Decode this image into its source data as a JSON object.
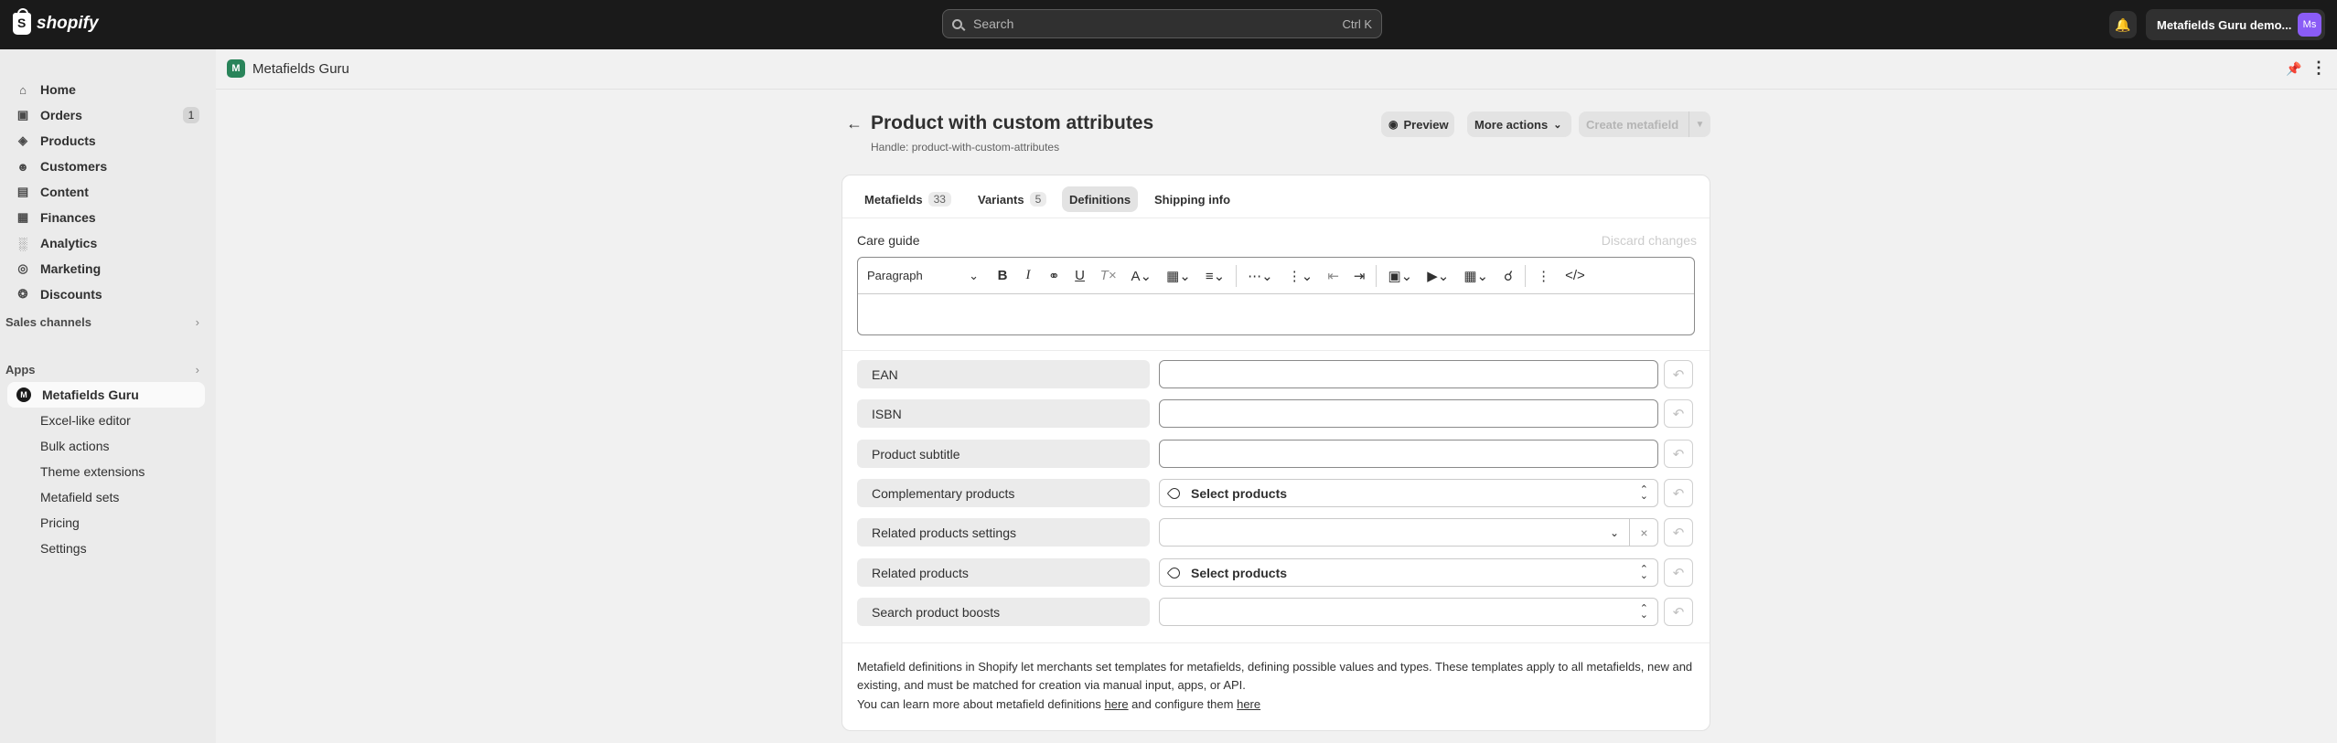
{
  "topbar": {
    "brand": "shopify",
    "search_placeholder": "Search",
    "search_shortcut": "Ctrl K",
    "store_name": "Metafields Guru demo...",
    "avatar_initials": "Ms"
  },
  "sidebar": {
    "items": [
      {
        "label": "Home",
        "icon": "home-icon"
      },
      {
        "label": "Orders",
        "icon": "orders-icon",
        "badge": "1"
      },
      {
        "label": "Products",
        "icon": "tag-icon"
      },
      {
        "label": "Customers",
        "icon": "person-icon"
      },
      {
        "label": "Content",
        "icon": "content-icon"
      },
      {
        "label": "Finances",
        "icon": "bank-icon"
      },
      {
        "label": "Analytics",
        "icon": "chart-icon"
      },
      {
        "label": "Marketing",
        "icon": "target-icon"
      },
      {
        "label": "Discounts",
        "icon": "discount-icon"
      }
    ],
    "sales_channels": "Sales channels",
    "apps": "Apps",
    "app_name": "Metafields Guru",
    "app_sub_items": [
      "Excel-like editor",
      "Bulk actions",
      "Theme extensions",
      "Metafield sets",
      "Pricing",
      "Settings"
    ]
  },
  "app_header": {
    "title": "Metafields Guru"
  },
  "page": {
    "title": "Product with custom attributes",
    "handle": "Handle: product-with-custom-attributes",
    "preview_label": "Preview",
    "more_actions_label": "More actions",
    "create_label": "Create metafield"
  },
  "tabs": [
    {
      "label": "Metafields",
      "count": "33"
    },
    {
      "label": "Variants",
      "count": "5"
    },
    {
      "label": "Definitions",
      "count": ""
    },
    {
      "label": "Shipping info",
      "count": ""
    }
  ],
  "editor": {
    "label": "Care guide",
    "discard_label": "Discard changes",
    "paragraph_label": "Paragraph"
  },
  "fields": [
    {
      "label": "EAN",
      "type": "text",
      "value": ""
    },
    {
      "label": "ISBN",
      "type": "text",
      "value": ""
    },
    {
      "label": "Product subtitle",
      "type": "text",
      "value": ""
    },
    {
      "label": "Complementary products",
      "type": "product-select",
      "value": "Select products"
    },
    {
      "label": "Related products settings",
      "type": "dropdown",
      "value": ""
    },
    {
      "label": "Related products",
      "type": "product-select",
      "value": "Select products"
    },
    {
      "label": "Search product boosts",
      "type": "select",
      "value": ""
    }
  ],
  "footer": {
    "paragraph": "Metafield definitions in Shopify let merchants set templates for metafields, defining possible values and types. These templates apply to all metafields, new and existing, and must be matched for creation via manual input, apps, or API.",
    "learn_prefix": "You can learn more about metafield definitions ",
    "link1": "here",
    "learn_middle": " and configure them ",
    "link2": "here"
  }
}
